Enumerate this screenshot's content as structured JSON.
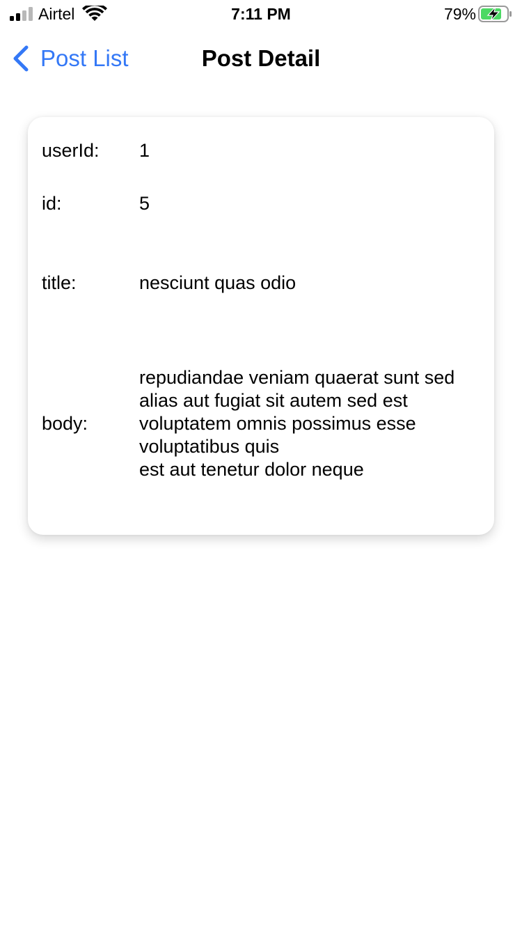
{
  "status_bar": {
    "carrier": "Airtel",
    "time": "7:11 PM",
    "battery_percent": "79%",
    "signal_icon": "cellular-signal-icon",
    "wifi_icon": "wifi-icon",
    "battery_icon": "battery-charging-icon"
  },
  "nav": {
    "back_label": "Post List",
    "back_icon": "chevron-left-icon",
    "title": "Post Detail",
    "accent_color": "#3478f6"
  },
  "post": {
    "userId_label": "userId:",
    "userId": "1",
    "id_label": "id:",
    "id": "5",
    "title_label": "title:",
    "title": "nesciunt quas odio",
    "body_label": "body:",
    "body": "repudiandae veniam quaerat sunt sed\nalias aut fugiat sit autem sed est\nvoluptatem omnis possimus esse\nvoluptatibus quis\nest aut tenetur dolor neque"
  }
}
